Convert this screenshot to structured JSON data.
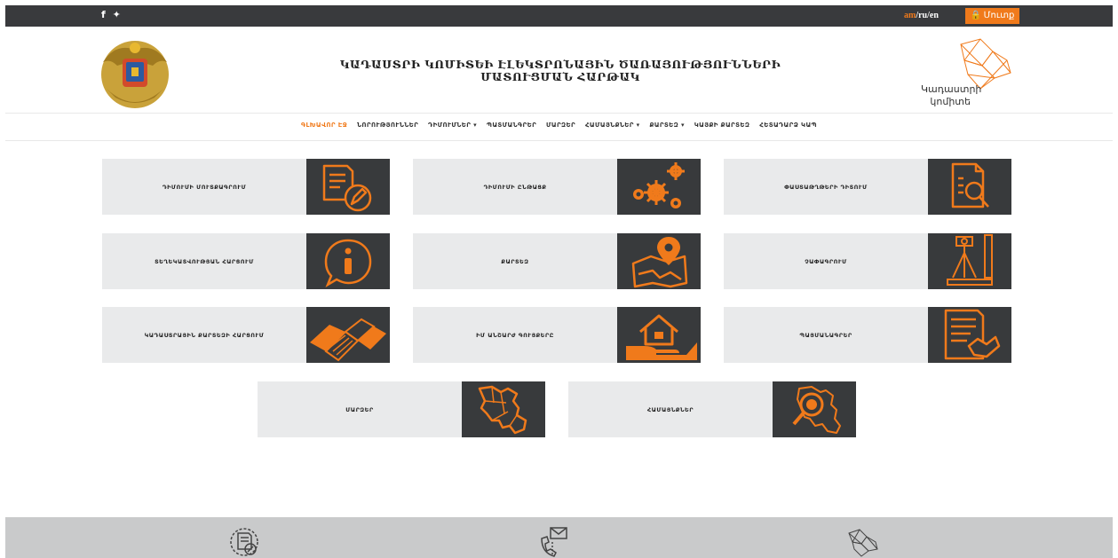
{
  "topbar": {
    "social": "f ✦",
    "lang_active": "am",
    "lang_rest": "/ru/en",
    "login_label": "🔒 Մուտք"
  },
  "header": {
    "title_line1": "ԿԱԴԱՍՏՐԻ ԿՈՄԻՏԵԻ ԷԼԵԿՏՐՈՆԱՅԻՆ ԾԱՌԱՅՈՒԹՅՈՒՆՆԵՐԻ",
    "title_line2": "ՄԱՏՈՒՑՄԱՆ ՀԱՐԹԱԿ",
    "logo_line1": "Կադաստրի",
    "logo_line2": "կոմիտե"
  },
  "nav": [
    {
      "label": "ԳԼԽԱՎՈՐ ԷՋ",
      "active": true
    },
    {
      "label": "ՆՈՐՈՒԹՅՈՒՆՆԵՐ"
    },
    {
      "label": "ԴԻՄՈՒՄՆԵՐ ▾"
    },
    {
      "label": "ՊԱՏՄԱՆԳՐԵՐ"
    },
    {
      "label": "ՄԱՐԶԵՐ"
    },
    {
      "label": "ՀԱՄԱՅՆՔՆԵՐ ▾"
    },
    {
      "label": "ՔԱՐՏԵԶ ▾"
    },
    {
      "label": "ԿԱՅՔԻ ՔԱՐՏԵԶ"
    },
    {
      "label": "ՀԵՏԱԴԱՐՁ ԿԱՊ"
    }
  ],
  "cards": [
    {
      "label": "ԴԻՄՈՒՄԻ ՄՈՒՏՔԱԳՐՈՒՄ",
      "icon": "document-pen-icon"
    },
    {
      "label": "ԴԻՄՈՒՄԻ ԸՆԹԱՑՔ",
      "icon": "gears-icon"
    },
    {
      "label": "ՓԱՍՏԱԹՂԹԵՐԻ ԴԻՏՈՒՄ",
      "icon": "document-search-icon"
    },
    {
      "label": "ՏԵՂԵԿԱՏՎՈՒԹՅԱՆ ՀԱՐՑՈՒՄ",
      "icon": "info-icon"
    },
    {
      "label": "ՔԱՐՏԵԶ",
      "icon": "map-pin-icon"
    },
    {
      "label": "ՉԱՓԱԳՐՈՒՄ",
      "icon": "survey-tripod-icon"
    },
    {
      "label": "ԿԱԴԱՍՏՐԱՅԻՆ ՔԱՐՏԵԶԻ ՀԱՐՑՈՒՄ",
      "icon": "cadastral-map-icon"
    },
    {
      "label": "ԻՄ ԱՆՇԱՐԺ ԳՈՒՅՔԵՐԸ",
      "icon": "house-hand-icon"
    },
    {
      "label": "ՊԱՅՄԱՆԱԳՐԵՐ",
      "icon": "contract-handshake-icon"
    },
    {
      "label": "ՄԱՐԶԵՐ",
      "icon": "armenia-map-icon"
    },
    {
      "label": "ՀԱՄԱՅՆՔՆԵՐ",
      "icon": "map-search-icon"
    }
  ],
  "colors": {
    "accent": "#f07a1b",
    "dark": "#383a3c",
    "card_bg": "#e9eaeb",
    "topbar": "#393a3d",
    "footer": "#c9cacb"
  }
}
